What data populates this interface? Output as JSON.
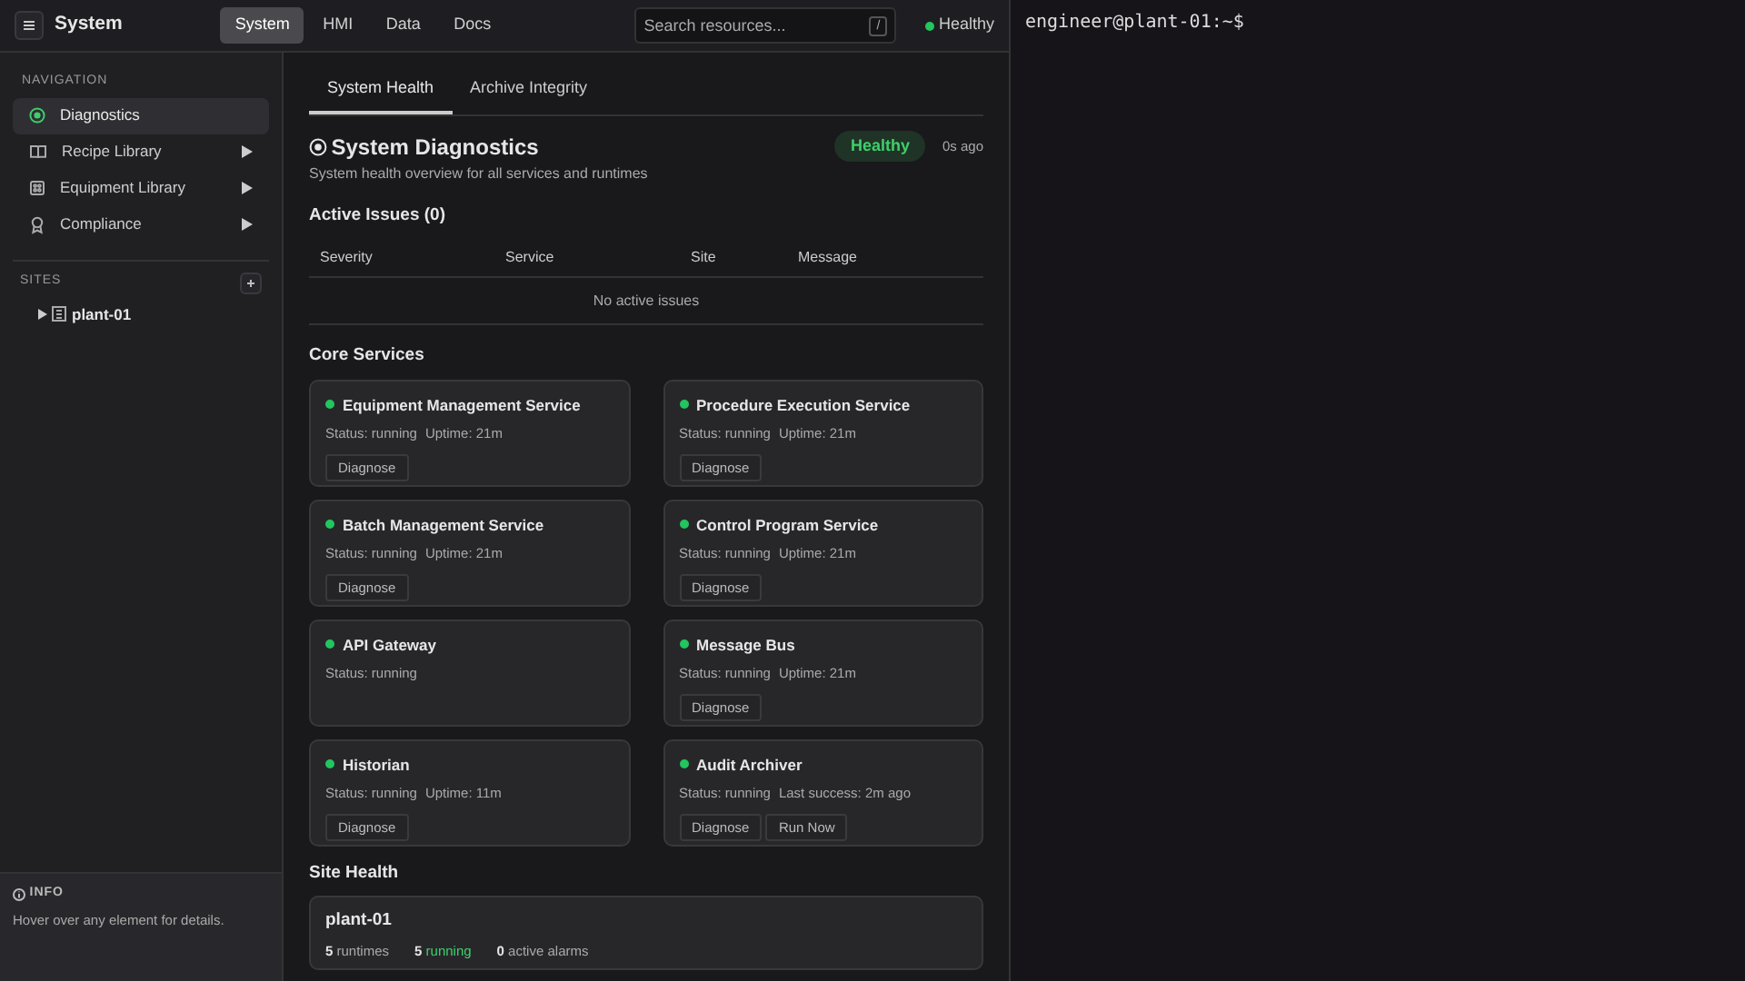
{
  "app": {
    "title": "System",
    "nav_tabs": [
      {
        "label": "System",
        "selected": true
      },
      {
        "label": "HMI",
        "selected": false
      },
      {
        "label": "Data",
        "selected": false
      },
      {
        "label": "Docs",
        "selected": false
      }
    ],
    "search": {
      "placeholder": "Search resources...",
      "shortcut": "/"
    },
    "health": {
      "label": "Healthy",
      "color": "#22c55e"
    }
  },
  "sidebar": {
    "section_title": "NAVIGATION",
    "items": [
      {
        "label": "Diagnostics",
        "kind": "target",
        "selected": true,
        "submenu": false
      },
      {
        "label": "Recipe Library",
        "kind": "book",
        "selected": false,
        "submenu": true
      },
      {
        "label": "Equipment Library",
        "kind": "equipment",
        "selected": false,
        "submenu": true
      },
      {
        "label": "Compliance",
        "kind": "award",
        "selected": false,
        "submenu": true
      }
    ],
    "sites_title": "SITES",
    "sites": [
      {
        "label": "plant-01",
        "expanded": false
      }
    ],
    "info": {
      "title": "INFO",
      "text": "Hover over any element for details."
    }
  },
  "main": {
    "tabs": [
      {
        "label": "System Health",
        "selected": true
      },
      {
        "label": "Archive Integrity",
        "selected": false
      }
    ],
    "title": "System Diagnostics",
    "subtitle": "System health overview for all services and runtimes",
    "status": "Healthy",
    "updated": "0s ago",
    "issues": {
      "title": "Active Issues (0)",
      "columns": [
        "Severity",
        "Service",
        "Site",
        "Message"
      ],
      "empty": "No active issues"
    },
    "services_title": "Core Services",
    "services": [
      {
        "name": "Equipment Management Service",
        "color": "#22c55e",
        "details": [
          "Status: running",
          "Uptime: 21m"
        ],
        "buttons": [
          "Diagnose"
        ]
      },
      {
        "name": "Procedure Execution Service",
        "color": "#22c55e",
        "details": [
          "Status: running",
          "Uptime: 21m"
        ],
        "buttons": [
          "Diagnose"
        ]
      },
      {
        "name": "Batch Management Service",
        "color": "#22c55e",
        "details": [
          "Status: running",
          "Uptime: 21m"
        ],
        "buttons": [
          "Diagnose"
        ]
      },
      {
        "name": "Control Program Service",
        "color": "#22c55e",
        "details": [
          "Status: running",
          "Uptime: 21m"
        ],
        "buttons": [
          "Diagnose"
        ]
      },
      {
        "name": "API Gateway",
        "color": "#22c55e",
        "details": [
          "Status: running"
        ]
      },
      {
        "name": "Message Bus",
        "color": "#22c55e",
        "details": [
          "Status: running",
          "Uptime: 21m"
        ],
        "buttons": [
          "Diagnose"
        ]
      },
      {
        "name": "Historian",
        "color": "#22c55e",
        "details": [
          "Status: running",
          "Uptime: 11m"
        ],
        "buttons": [
          "Diagnose"
        ]
      },
      {
        "name": "Audit Archiver",
        "color": "#22c55e",
        "details": [
          "Status: running",
          "Last success: 2m ago"
        ],
        "buttons": [
          "Diagnose",
          "Run Now"
        ]
      }
    ],
    "site_health_title": "Site Health",
    "sites": [
      {
        "name": "plant-01",
        "stats": [
          {
            "text": "**5** runtimes",
            "kind": "plain"
          },
          {
            "text": "**5** running",
            "kind": "good"
          },
          {
            "text": "**0** active alarms",
            "kind": "plain"
          }
        ]
      }
    ]
  },
  "terminal": {
    "prompt": "engineer@plant-01:~$"
  }
}
